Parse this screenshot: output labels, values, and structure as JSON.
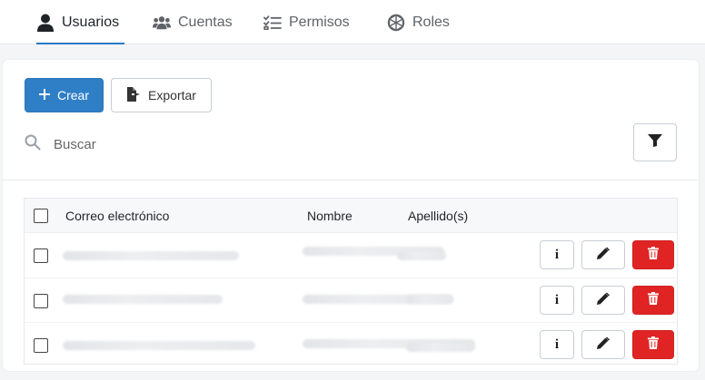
{
  "tabs": [
    {
      "label": "Usuarios",
      "icon": "user-icon",
      "active": true
    },
    {
      "label": "Cuentas",
      "icon": "users-group-icon",
      "active": false
    },
    {
      "label": "Permisos",
      "icon": "checklist-icon",
      "active": false
    },
    {
      "label": "Roles",
      "icon": "roles-globe-icon",
      "active": false
    }
  ],
  "toolbar": {
    "create_label": "Crear",
    "export_label": "Exportar"
  },
  "search": {
    "placeholder": "Buscar",
    "value": ""
  },
  "table": {
    "columns": [
      "Correo electrónico",
      "Nombre",
      "Apellido(s)"
    ],
    "rows": [
      {
        "email": "",
        "name": "",
        "surname": ""
      },
      {
        "email": "",
        "name": "",
        "surname": ""
      },
      {
        "email": "",
        "name": "",
        "surname": ""
      }
    ],
    "row_actions": {
      "info_label": "i"
    }
  },
  "colors": {
    "primary": "#2f7fc7",
    "danger": "#e02424",
    "active_tab_underline": "#2b78c5"
  }
}
